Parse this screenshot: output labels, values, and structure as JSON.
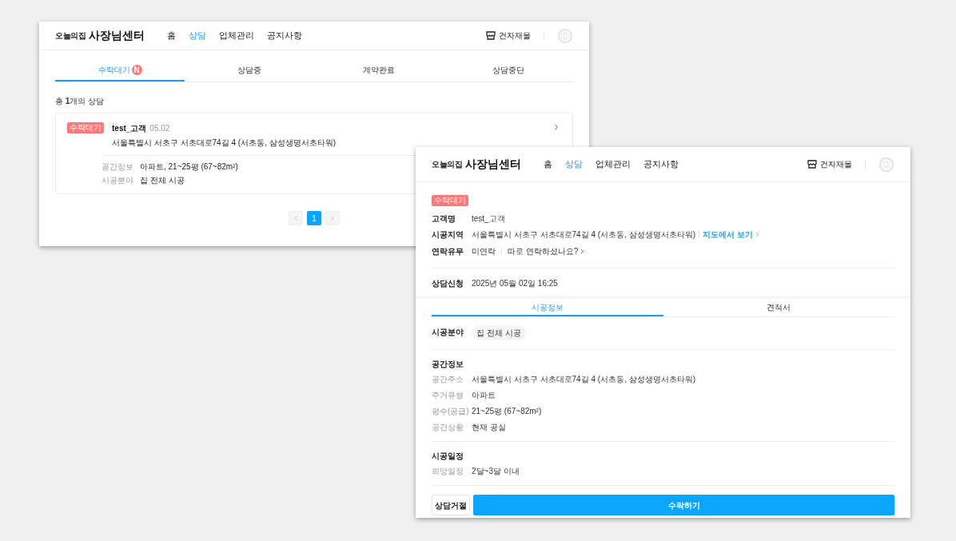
{
  "list_window": {
    "header": {
      "brand_small": "오늘의집",
      "brand": "사장님센터",
      "nav": [
        {
          "label": "홈",
          "selected": false
        },
        {
          "label": "상담",
          "selected": true
        },
        {
          "label": "업체관리",
          "selected": false
        },
        {
          "label": "공지사항",
          "selected": false
        }
      ],
      "mall": "건자재몰"
    },
    "tabs": [
      {
        "label": "수락대기",
        "badge": "N",
        "selected": true
      },
      {
        "label": "상담중",
        "selected": false
      },
      {
        "label": "계약완료",
        "selected": false
      },
      {
        "label": "상담중단",
        "selected": false
      }
    ],
    "count_text": "총 **1**개의 상담",
    "cards": [
      {
        "status": "수락대기",
        "name": "test_고객",
        "date": "05.02",
        "address": "서울특별시 서초구 서초대로74길 4 (서초동, 삼성생명서초타워)",
        "details": [
          {
            "label": "공간정보",
            "value": "아파트, 21~25평 (67~82m²)"
          },
          {
            "label": "시공분야",
            "value": "집 전체 시공"
          }
        ]
      }
    ],
    "pagination": {
      "pages": [
        {
          "label": "1",
          "selected": true
        }
      ]
    }
  },
  "detail_window": {
    "header": {
      "brand_small": "오늘의집",
      "brand": "사장님센터",
      "nav": [
        {
          "label": "홈",
          "selected": false
        },
        {
          "label": "상담",
          "selected": true
        },
        {
          "label": "업체관리",
          "selected": false
        },
        {
          "label": "공지사항",
          "selected": false
        }
      ],
      "mall": "건자재몰"
    },
    "status": "수락대기",
    "info": [
      {
        "label": "고객명",
        "value": "test_고객"
      },
      {
        "label": "시공지역",
        "value": "서울특별시 서초구 서초대로74길 4 (서초동, 삼성생명서초타워)",
        "link": "지도에서 보기"
      },
      {
        "label": "연락유무",
        "value": "미연락",
        "action": "따로 연락하셨나요?"
      }
    ],
    "requested": {
      "label": "상담신청",
      "value": "2025년 05월 02일 16:25"
    },
    "tabs": [
      {
        "label": "시공정보",
        "selected": true
      },
      {
        "label": "견적서",
        "selected": false
      }
    ],
    "field": {
      "label": "시공분야",
      "chip": "집 전체 시공"
    },
    "sections": [
      {
        "title": "공간정보",
        "rows": [
          {
            "label": "공간주소",
            "value": "서울특별시 서초구 서초대로74길 4 (서초동, 삼성생명서초타워)"
          },
          {
            "label": "주거유형",
            "value": "아파트"
          },
          {
            "label": "평수(공급)",
            "value": "21~25평 (67~82m²)"
          },
          {
            "label": "공간상황",
            "value": "현재 공실"
          }
        ]
      },
      {
        "title": "시공일정",
        "rows": [
          {
            "label": "희망일정",
            "value": "2달~3달 이내"
          }
        ]
      }
    ],
    "buttons": {
      "reject": "상담거절",
      "accept": "수락하기"
    }
  }
}
